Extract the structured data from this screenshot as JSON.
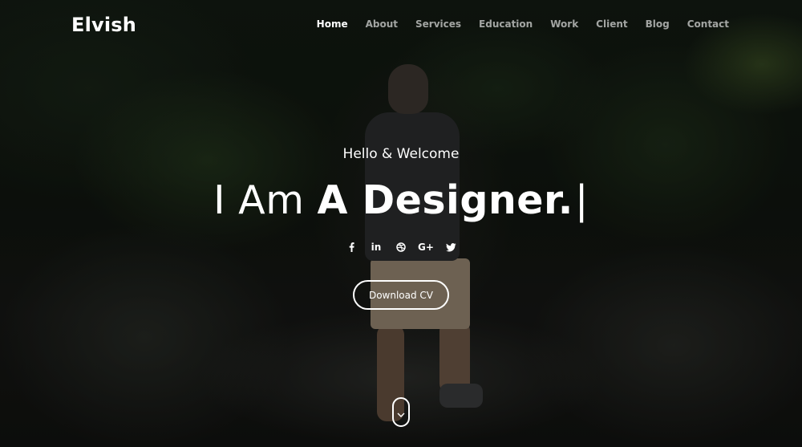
{
  "brand": {
    "logo": "Elvish"
  },
  "nav": {
    "items": [
      {
        "label": "Home",
        "active": true
      },
      {
        "label": "About"
      },
      {
        "label": "Services"
      },
      {
        "label": "Education"
      },
      {
        "label": "Work"
      },
      {
        "label": "Client"
      },
      {
        "label": "Blog"
      },
      {
        "label": "Contact"
      }
    ]
  },
  "hero": {
    "greeting": "Hello & Welcome",
    "headline_prefix": "I Am",
    "headline_bold": "A Designer.",
    "caret": "|",
    "socials": [
      {
        "icon": "facebook-icon"
      },
      {
        "icon": "linkedin-icon",
        "text": "in"
      },
      {
        "icon": "dribbble-icon"
      },
      {
        "icon": "google-plus-icon",
        "text": "G+"
      },
      {
        "icon": "twitter-icon"
      }
    ],
    "cta_label": "Download CV",
    "scroll_icon": "chevron-down-icon"
  },
  "colors": {
    "text": "#ffffff",
    "nav_inactive": "rgba(255,255,255,0.62)",
    "background": "#0e110d"
  }
}
